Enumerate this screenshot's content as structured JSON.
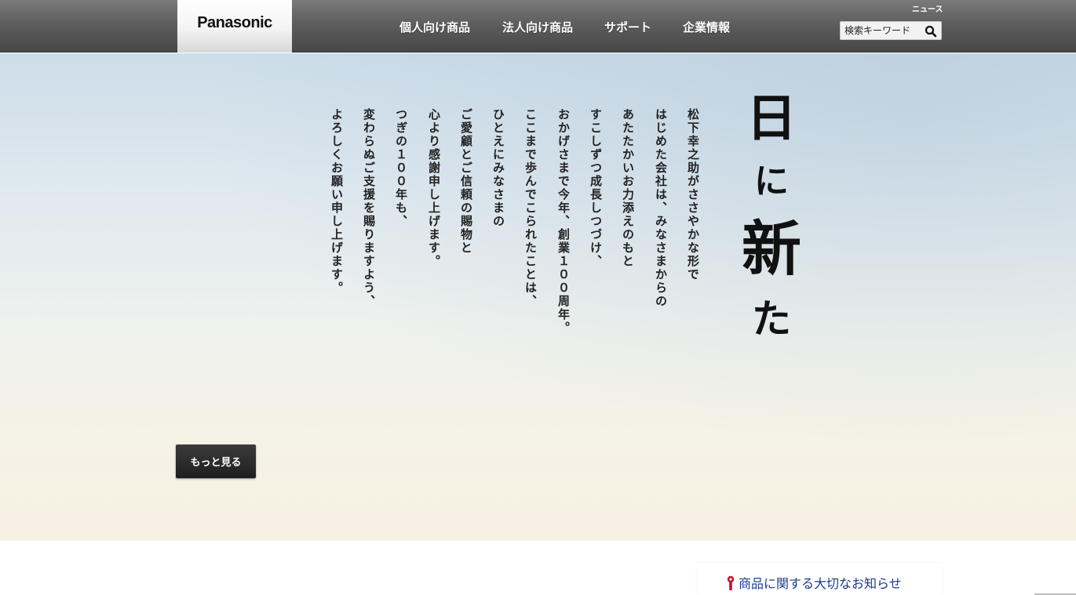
{
  "header": {
    "logo_text": "Panasonic",
    "news_label": "ニュース",
    "nav": [
      {
        "label": "個人向け商品"
      },
      {
        "label": "法人向け商品"
      },
      {
        "label": "サポート"
      },
      {
        "label": "企業情報"
      }
    ],
    "search": {
      "placeholder": "検索キーワード",
      "icon": "search-icon"
    }
  },
  "hero": {
    "calligraphy": [
      "日",
      "に",
      "新",
      "た"
    ],
    "poem_lines": [
      "松下幸之助がささやかな形で",
      "はじめた会社は、みなさまからの",
      "あたたかいお力添えのもと",
      "すこしずつ成長しつづけ、",
      "おかげさまで今年、創業１００周年。",
      "ここまで歩んでこられたことは、",
      "ひとえにみなさまの",
      "ご愛顧とご信頼の賜物と",
      "心より感謝申し上げます。",
      "つぎの１００年も、",
      "変わらぬご支援を賜りますよう、",
      "よろしくお願い申し上げます。"
    ],
    "more_button": "もっと見る"
  },
  "notice": {
    "label": "商品に関する大切なお知らせ",
    "icon": "alert-pin-icon",
    "icon_color": "#c8102e",
    "link_color": "#1a3a8f"
  }
}
